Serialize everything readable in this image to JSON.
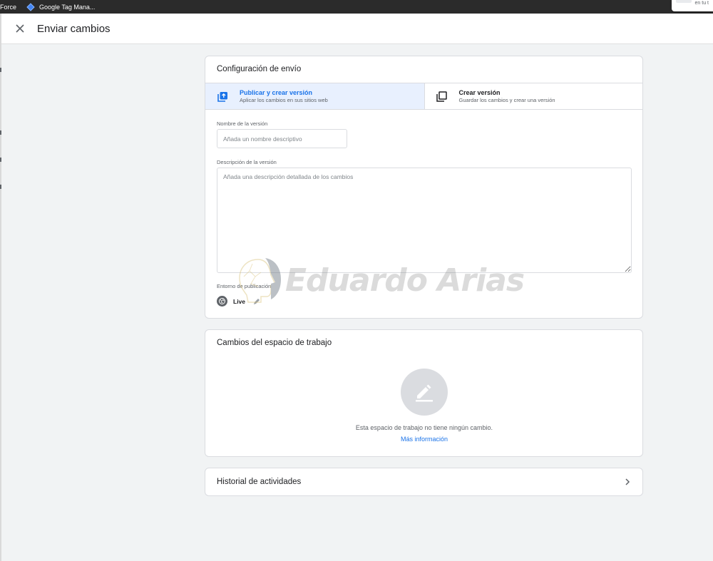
{
  "bookmarks": [
    {
      "label": "Force"
    },
    {
      "label": "Google Tag Mana..."
    }
  ],
  "corner_popup": {
    "text": "en tu t"
  },
  "header": {
    "title": "Enviar cambios",
    "close_icon": "close-icon"
  },
  "config": {
    "title": "Configuración de envío",
    "options": [
      {
        "title": "Publicar y crear versión",
        "subtitle": "Aplicar los cambios en sus sitios web",
        "icon": "publish-icon",
        "selected": true
      },
      {
        "title": "Crear versión",
        "subtitle": "Guardar los cambios y crear una versión",
        "icon": "copy-icon",
        "selected": false
      }
    ],
    "version_name_label": "Nombre de la versión",
    "version_name_placeholder": "Añada un nombre descriptivo",
    "version_desc_label": "Descripción de la versión",
    "version_desc_placeholder": "Añada una descripción detallada de los cambios",
    "environment_label": "Entorno de publicación",
    "environment_name": "Live"
  },
  "watermark": {
    "text": "Eduardo Arias"
  },
  "workspace_changes": {
    "title": "Cambios del espacio de trabajo",
    "empty_text": "Esta espacio de trabajo no tiene ningún cambio.",
    "link": "Más información"
  },
  "activity_history": {
    "title": "Historial de actividades"
  },
  "colors": {
    "accent": "#1a73e8",
    "selected_bg": "#e8f0fe",
    "page_bg": "#f1f3f4",
    "bookmarks_bar": "#2b2b2b"
  }
}
